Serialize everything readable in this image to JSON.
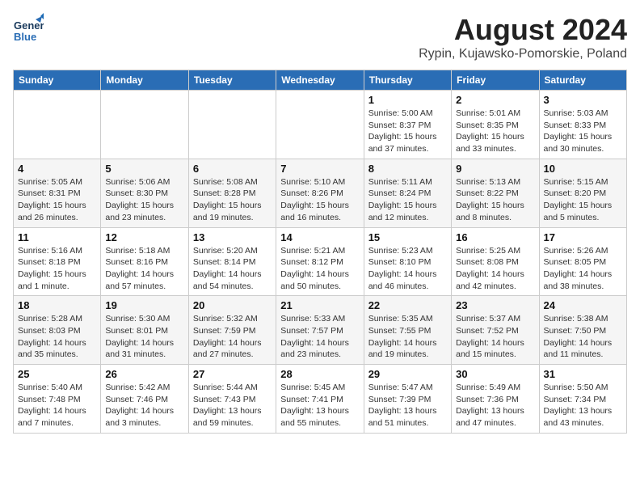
{
  "header": {
    "logo_general": "General",
    "logo_blue": "Blue",
    "month": "August 2024",
    "location": "Rypin, Kujawsko-Pomorskie, Poland"
  },
  "weekdays": [
    "Sunday",
    "Monday",
    "Tuesday",
    "Wednesday",
    "Thursday",
    "Friday",
    "Saturday"
  ],
  "weeks": [
    [
      {
        "day": "",
        "info": ""
      },
      {
        "day": "",
        "info": ""
      },
      {
        "day": "",
        "info": ""
      },
      {
        "day": "",
        "info": ""
      },
      {
        "day": "1",
        "info": "Sunrise: 5:00 AM\nSunset: 8:37 PM\nDaylight: 15 hours\nand 37 minutes."
      },
      {
        "day": "2",
        "info": "Sunrise: 5:01 AM\nSunset: 8:35 PM\nDaylight: 15 hours\nand 33 minutes."
      },
      {
        "day": "3",
        "info": "Sunrise: 5:03 AM\nSunset: 8:33 PM\nDaylight: 15 hours\nand 30 minutes."
      }
    ],
    [
      {
        "day": "4",
        "info": "Sunrise: 5:05 AM\nSunset: 8:31 PM\nDaylight: 15 hours\nand 26 minutes."
      },
      {
        "day": "5",
        "info": "Sunrise: 5:06 AM\nSunset: 8:30 PM\nDaylight: 15 hours\nand 23 minutes."
      },
      {
        "day": "6",
        "info": "Sunrise: 5:08 AM\nSunset: 8:28 PM\nDaylight: 15 hours\nand 19 minutes."
      },
      {
        "day": "7",
        "info": "Sunrise: 5:10 AM\nSunset: 8:26 PM\nDaylight: 15 hours\nand 16 minutes."
      },
      {
        "day": "8",
        "info": "Sunrise: 5:11 AM\nSunset: 8:24 PM\nDaylight: 15 hours\nand 12 minutes."
      },
      {
        "day": "9",
        "info": "Sunrise: 5:13 AM\nSunset: 8:22 PM\nDaylight: 15 hours\nand 8 minutes."
      },
      {
        "day": "10",
        "info": "Sunrise: 5:15 AM\nSunset: 8:20 PM\nDaylight: 15 hours\nand 5 minutes."
      }
    ],
    [
      {
        "day": "11",
        "info": "Sunrise: 5:16 AM\nSunset: 8:18 PM\nDaylight: 15 hours\nand 1 minute."
      },
      {
        "day": "12",
        "info": "Sunrise: 5:18 AM\nSunset: 8:16 PM\nDaylight: 14 hours\nand 57 minutes."
      },
      {
        "day": "13",
        "info": "Sunrise: 5:20 AM\nSunset: 8:14 PM\nDaylight: 14 hours\nand 54 minutes."
      },
      {
        "day": "14",
        "info": "Sunrise: 5:21 AM\nSunset: 8:12 PM\nDaylight: 14 hours\nand 50 minutes."
      },
      {
        "day": "15",
        "info": "Sunrise: 5:23 AM\nSunset: 8:10 PM\nDaylight: 14 hours\nand 46 minutes."
      },
      {
        "day": "16",
        "info": "Sunrise: 5:25 AM\nSunset: 8:08 PM\nDaylight: 14 hours\nand 42 minutes."
      },
      {
        "day": "17",
        "info": "Sunrise: 5:26 AM\nSunset: 8:05 PM\nDaylight: 14 hours\nand 38 minutes."
      }
    ],
    [
      {
        "day": "18",
        "info": "Sunrise: 5:28 AM\nSunset: 8:03 PM\nDaylight: 14 hours\nand 35 minutes."
      },
      {
        "day": "19",
        "info": "Sunrise: 5:30 AM\nSunset: 8:01 PM\nDaylight: 14 hours\nand 31 minutes."
      },
      {
        "day": "20",
        "info": "Sunrise: 5:32 AM\nSunset: 7:59 PM\nDaylight: 14 hours\nand 27 minutes."
      },
      {
        "day": "21",
        "info": "Sunrise: 5:33 AM\nSunset: 7:57 PM\nDaylight: 14 hours\nand 23 minutes."
      },
      {
        "day": "22",
        "info": "Sunrise: 5:35 AM\nSunset: 7:55 PM\nDaylight: 14 hours\nand 19 minutes."
      },
      {
        "day": "23",
        "info": "Sunrise: 5:37 AM\nSunset: 7:52 PM\nDaylight: 14 hours\nand 15 minutes."
      },
      {
        "day": "24",
        "info": "Sunrise: 5:38 AM\nSunset: 7:50 PM\nDaylight: 14 hours\nand 11 minutes."
      }
    ],
    [
      {
        "day": "25",
        "info": "Sunrise: 5:40 AM\nSunset: 7:48 PM\nDaylight: 14 hours\nand 7 minutes."
      },
      {
        "day": "26",
        "info": "Sunrise: 5:42 AM\nSunset: 7:46 PM\nDaylight: 14 hours\nand 3 minutes."
      },
      {
        "day": "27",
        "info": "Sunrise: 5:44 AM\nSunset: 7:43 PM\nDaylight: 13 hours\nand 59 minutes."
      },
      {
        "day": "28",
        "info": "Sunrise: 5:45 AM\nSunset: 7:41 PM\nDaylight: 13 hours\nand 55 minutes."
      },
      {
        "day": "29",
        "info": "Sunrise: 5:47 AM\nSunset: 7:39 PM\nDaylight: 13 hours\nand 51 minutes."
      },
      {
        "day": "30",
        "info": "Sunrise: 5:49 AM\nSunset: 7:36 PM\nDaylight: 13 hours\nand 47 minutes."
      },
      {
        "day": "31",
        "info": "Sunrise: 5:50 AM\nSunset: 7:34 PM\nDaylight: 13 hours\nand 43 minutes."
      }
    ]
  ]
}
